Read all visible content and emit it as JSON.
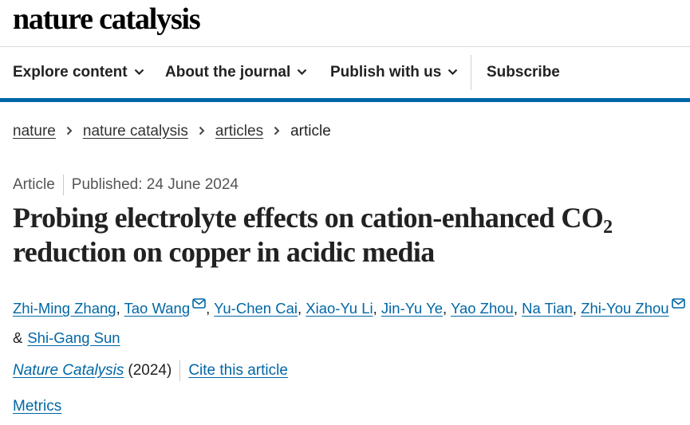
{
  "site": {
    "logo_text": "nature catalysis"
  },
  "nav": {
    "items": [
      {
        "label": "Explore content",
        "has_dropdown": true
      },
      {
        "label": "About the journal",
        "has_dropdown": true
      },
      {
        "label": "Publish with us",
        "has_dropdown": true
      },
      {
        "label": "Subscribe",
        "has_dropdown": false
      }
    ]
  },
  "breadcrumb": {
    "items": [
      "nature",
      "nature catalysis",
      "articles"
    ],
    "current": "article"
  },
  "article": {
    "type": "Article",
    "published": "Published: 24 June 2024",
    "title_line1_main": "Probing electrolyte effects on cation-enhanced CO",
    "title_line1_sub": "2",
    "title_line2": "reduction on copper in acidic media",
    "authors": [
      {
        "name": "Zhi-Ming Zhang",
        "corresponding": false
      },
      {
        "name": "Tao Wang",
        "corresponding": true
      },
      {
        "name": "Yu-Chen Cai",
        "corresponding": false
      },
      {
        "name": "Xiao-Yu Li",
        "corresponding": false
      },
      {
        "name": "Jin-Yu Ye",
        "corresponding": false
      },
      {
        "name": "Yao Zhou",
        "corresponding": false
      },
      {
        "name": "Na Tian",
        "corresponding": false
      },
      {
        "name": "Zhi-You Zhou",
        "corresponding": true
      },
      {
        "name": "Shi-Gang Sun",
        "corresponding": false
      }
    ],
    "author_separator": ",",
    "author_last_joiner": "&",
    "journal_name": "Nature Catalysis",
    "journal_year": "(2024)",
    "cite_label": "Cite this article",
    "metrics_label": "Metrics"
  },
  "colors": {
    "link": "#0067a5",
    "accent_bar": "#0067a5",
    "text": "#222222"
  },
  "icons": {
    "nav_dropdown": "chevron-down-icon",
    "breadcrumb_separator": "chevron-right-icon",
    "corresponding_author": "mail-icon"
  }
}
